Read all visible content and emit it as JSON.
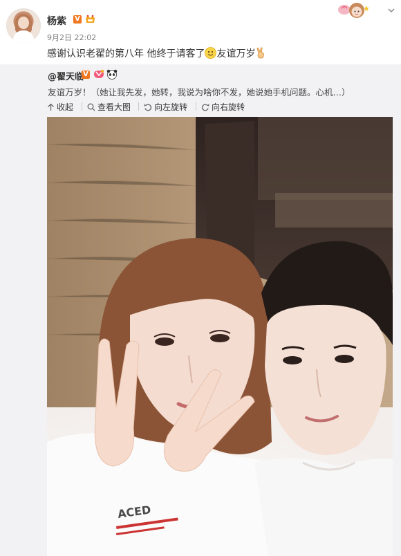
{
  "post": {
    "username": "杨紫",
    "vip_badge": "V",
    "timestamp": "9月2日 22:02",
    "text_before_emoji": "感谢认识老翟的第八年 他终于请客了",
    "text_after_emoji": "友谊万岁",
    "icons": [
      "smile-emoji-icon",
      "victory-hand-emoji-icon",
      "chevron-down-icon"
    ]
  },
  "repost": {
    "author": "@翟天临",
    "vip_badge": "V",
    "text": "友谊万岁！（她让我先发，她转，我说为啥你不发，她说她手机问题。心机…）",
    "actions": {
      "collapse": "收起",
      "view_large": "查看大图",
      "rotate_left": "向左旋转",
      "rotate_right": "向右旋转"
    }
  },
  "photo": {
    "shirt_print": "ACED"
  },
  "colors": {
    "repost_bg": "#f2f2f5",
    "vip_orange": "#f07820",
    "meta_gray": "#808080"
  }
}
